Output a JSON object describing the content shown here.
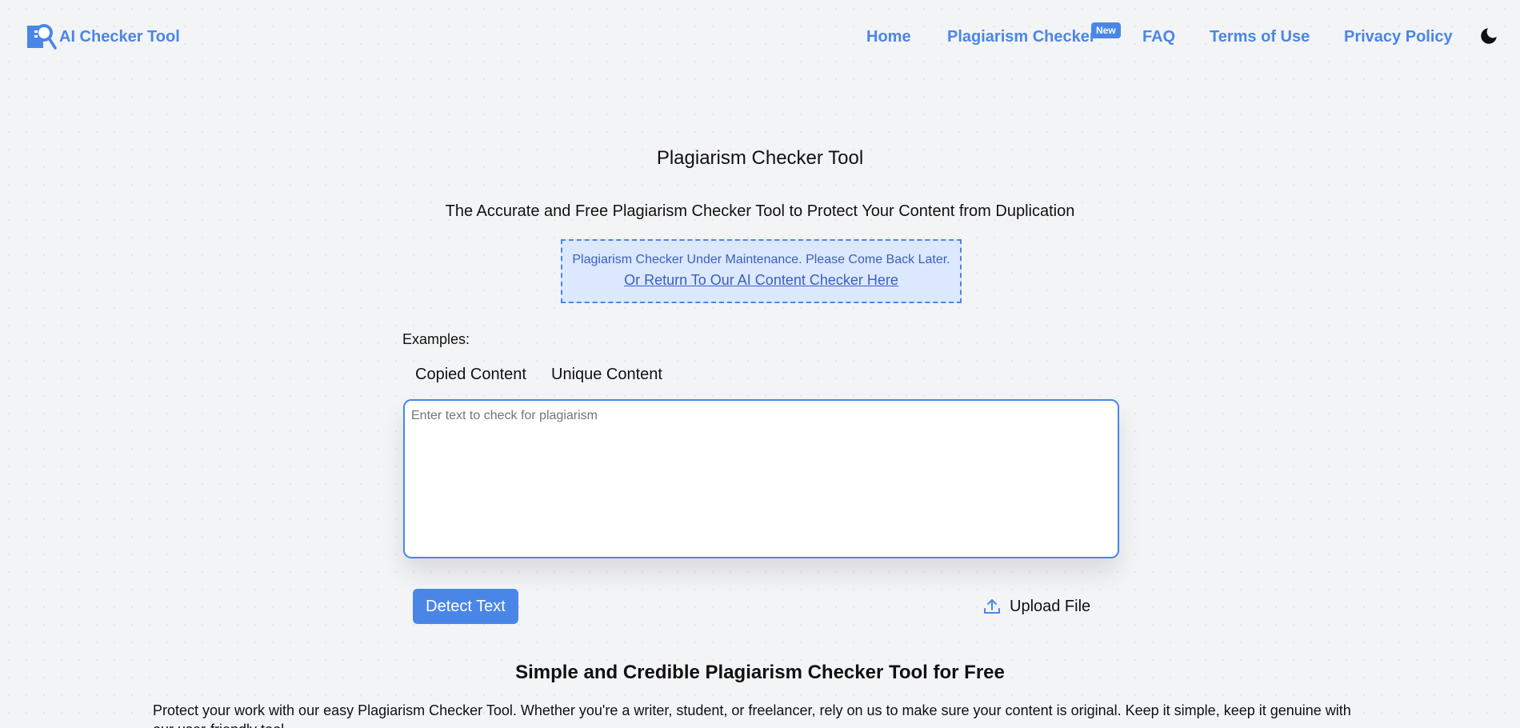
{
  "header": {
    "logo_text": "AI Checker Tool",
    "nav": [
      {
        "label": "Home"
      },
      {
        "label": "Plagiarism Checker",
        "badge": "New"
      },
      {
        "label": "FAQ"
      },
      {
        "label": "Terms of Use"
      },
      {
        "label": "Privacy Policy"
      }
    ],
    "theme_icon": "moon-icon"
  },
  "main": {
    "title": "Plagiarism Checker Tool",
    "subtitle": "The Accurate and Free Plagiarism Checker Tool to Protect Your Content from Duplication",
    "notice": {
      "message": "Plagiarism Checker Under Maintenance. Please Come Back Later.",
      "link": "Or Return To Our AI Content Checker Here"
    },
    "examples_label": "Examples:",
    "examples": [
      "Copied Content",
      "Unique Content"
    ],
    "input": {
      "placeholder": "Enter text to check for plagiarism",
      "value": ""
    },
    "detect_button": "Detect Text",
    "upload_button": "Upload File",
    "upload_icon": "upload-icon"
  },
  "section": {
    "heading": "Simple and Credible Plagiarism Checker Tool for Free",
    "body": "Protect your work with our easy Plagiarism Checker Tool. Whether you're a writer, student, or freelancer, rely on us to make sure your content is original. Keep it simple, keep it genuine with our user-friendly tool."
  },
  "colors": {
    "accent": "#4a86e8",
    "notice_bg": "#dbe8fd",
    "notice_text": "#3b5fc0",
    "background": "#f3f4f6"
  }
}
